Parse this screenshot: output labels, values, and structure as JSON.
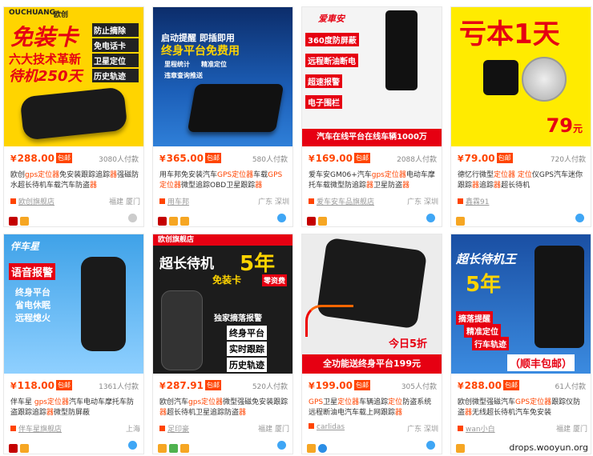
{
  "watermark": "drops.wooyun.org",
  "products": [
    {
      "price": "288.00",
      "yen": "¥",
      "badge": "包邮",
      "sold": "3080人付款",
      "title_parts": [
        "欧创",
        "gps定位器",
        "免安装跟踪追踪",
        "器",
        "强磁防水超长待机车载汽车防盗",
        "器"
      ],
      "shop": "欧创旗舰店",
      "location": "福建 厦门",
      "img": {
        "brand": "OUCHUANG",
        "brand_cn": "欧创",
        "l1": "免装卡",
        "l2": "六大技术革新",
        "l3": "待机250天",
        "t1": "防止摘除",
        "t2": "免电话卡",
        "t3": "卫星定位",
        "t4": "历史轨迹"
      }
    },
    {
      "price": "365.00",
      "yen": "¥",
      "badge": "包邮",
      "sold": "580人付款",
      "title_parts": [
        "用车邦免安装汽车",
        "GPS定位器",
        "车载",
        "GPS定位器",
        "微型追踪OBD卫星跟踪",
        "器"
      ],
      "shop": "用车邦",
      "location": "广东 深圳",
      "img": {
        "l1": "启动提醒 即插即用",
        "l2": "终身平台免费用",
        "t1": "里程统计",
        "t2": "精准定位",
        "t3": "违章查询推送"
      }
    },
    {
      "price": "169.00",
      "yen": "¥",
      "badge": "包邮",
      "sold": "2088人付款",
      "title_parts": [
        "爱车安GM06+汽车",
        "gps定位器",
        "电动车摩托车载微型防追踪",
        "器",
        "卫星防盗",
        "器"
      ],
      "shop": "爱车安车品旗舰店",
      "location": "广东 深圳",
      "img": {
        "brand": "爱車安",
        "l1": "360度防屏蔽",
        "l2": "远程断油断电",
        "l3": "超速报警",
        "l4": "电子围栏",
        "l5": "汽车在线平台在线车辆1000万"
      }
    },
    {
      "price": "79.00",
      "yen": "¥",
      "badge": "包邮",
      "sold": "720人付款",
      "title_parts": [
        "德忆行微型",
        "定位器 定位",
        "仪GPS汽车迷你 跟踪",
        "器",
        "追踪",
        "器",
        "超长待机"
      ],
      "shop": "鑫霖91",
      "location": "",
      "img": {
        "l1": "亏本1天",
        "price": "79",
        "unit": "元"
      }
    },
    {
      "price": "118.00",
      "yen": "¥",
      "badge": "包邮",
      "sold": "1361人付款",
      "title_parts": [
        "伴车星 ",
        "gps定位器",
        "汽车电动车摩托车防盗跟踪追踪",
        "器",
        "微型防屏蔽"
      ],
      "shop": "伴车星旗舰店",
      "location": "上海",
      "img": {
        "brand": "伴车星",
        "l1": "语音报警",
        "l2": "终身平台",
        "l3": "省电休眠",
        "l4": "远程熄火"
      }
    },
    {
      "price": "287.91",
      "yen": "¥",
      "badge": "包邮",
      "sold": "520人付款",
      "title_parts": [
        "欧创汽车",
        "gps定位器",
        "微型强磁免安装跟踪",
        "器",
        "超长待机卫星追踪防盗",
        "器"
      ],
      "shop": "足印豪",
      "location": "福建 厦门",
      "img": {
        "top": "欧创旗舰店",
        "l1": "超长待机",
        "l2": "5年",
        "l3": "免装卡",
        "l4": "零资费",
        "t1": "独家摘落报警",
        "t2": "终身平台",
        "t3": "实时跟踪",
        "t4": "历史轨迹"
      }
    },
    {
      "price": "199.00",
      "yen": "¥",
      "badge": "包邮",
      "sold": "305人付款",
      "title_parts": [
        "GPS",
        "卫星",
        "定位器",
        "车辆追踪",
        "定位",
        "防盗系统远程断油电汽车载上网跟踪",
        "器"
      ],
      "shop": "carlidas",
      "location": "广东 深圳",
      "img": {
        "l1": "今日5折",
        "l2": "全功能送终身平台199元"
      }
    },
    {
      "price": "288.00",
      "yen": "¥",
      "badge": "包邮",
      "sold": "61人付款",
      "title_parts": [
        "欧创微型强磁汽车",
        "GPS定位器",
        "跟踪仪防盗",
        "器",
        "无线超长待机汽车免安装"
      ],
      "shop": "wan小白",
      "location": "福建 厦门",
      "img": {
        "l1": "超长待机王",
        "l2": "5年",
        "t1": "摘落提醒",
        "t2": "精准定位",
        "t3": "行车轨迹",
        "t4": "（顺丰包邮）"
      }
    }
  ]
}
